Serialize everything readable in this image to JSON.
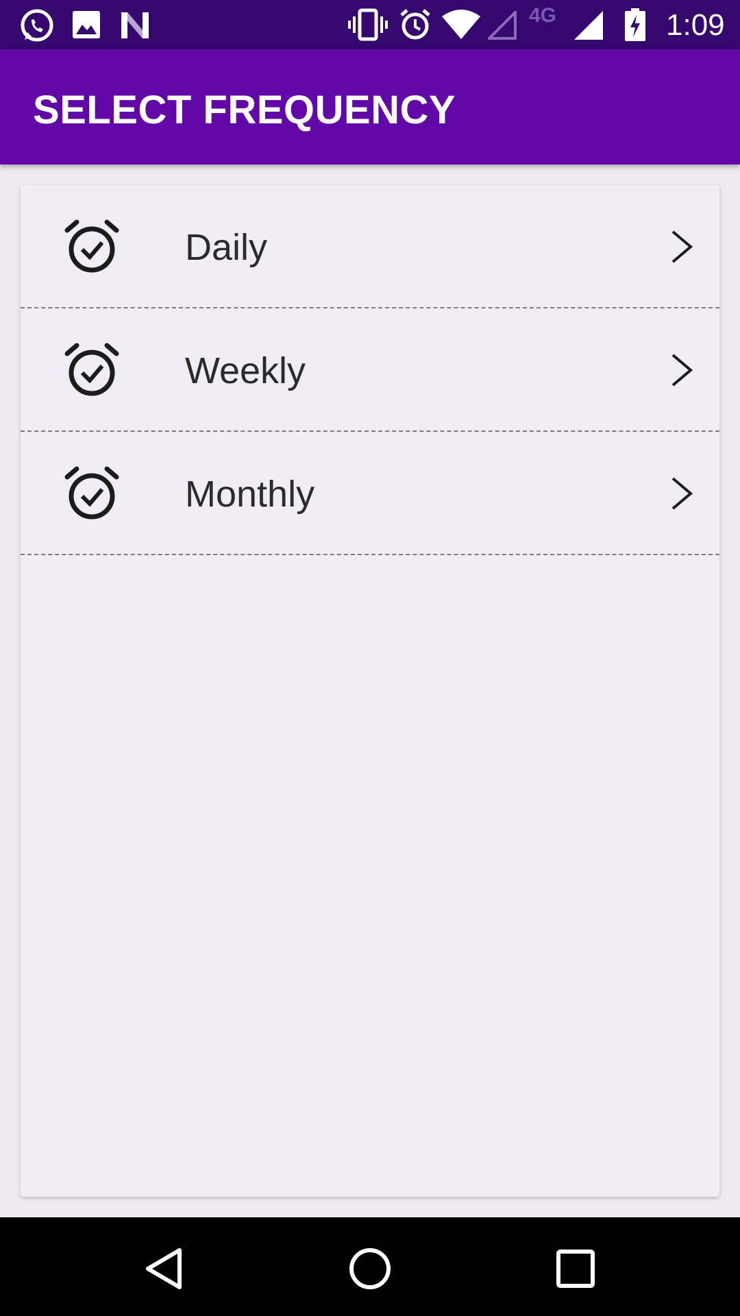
{
  "status_bar": {
    "time": "1:09",
    "network_label": "4G",
    "left_icons": [
      "whatsapp-icon",
      "image-icon",
      "n-logo-icon"
    ],
    "right_icons": [
      "vibrate-icon",
      "alarm-icon",
      "wifi-icon",
      "signal-weak-icon",
      "signal-icon",
      "battery-charging-icon"
    ]
  },
  "app_bar": {
    "title": "SELECT FREQUENCY",
    "color": "#6308a8"
  },
  "frequency_list": {
    "items": [
      {
        "label": "Daily",
        "icon": "alarm-check-icon"
      },
      {
        "label": "Weekly",
        "icon": "alarm-check-icon"
      },
      {
        "label": "Monthly",
        "icon": "alarm-check-icon"
      }
    ]
  },
  "navigation": {
    "buttons": [
      "back-icon",
      "home-icon",
      "recents-icon"
    ]
  }
}
